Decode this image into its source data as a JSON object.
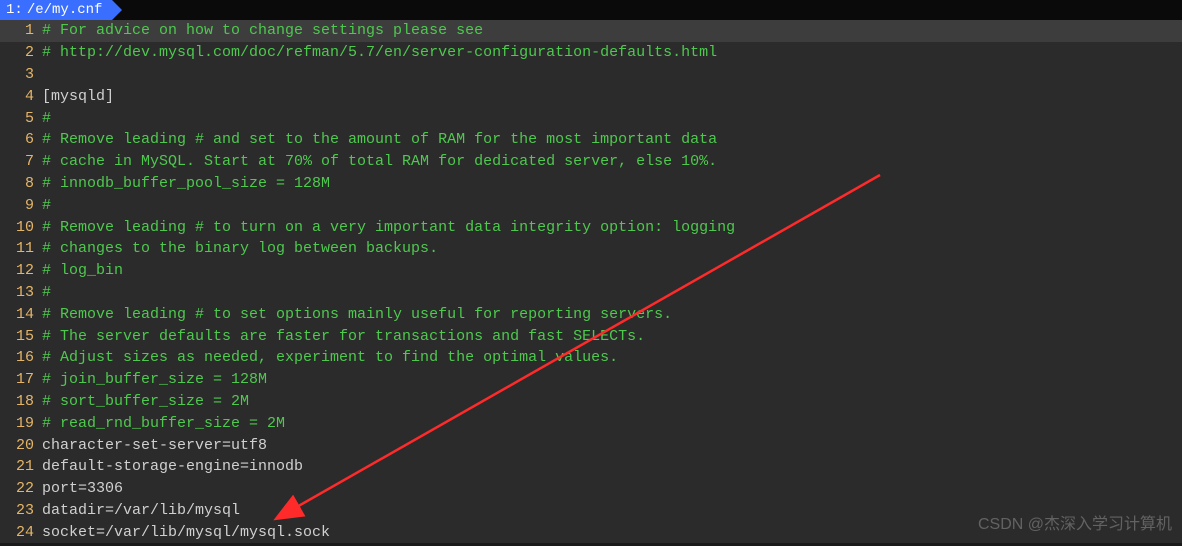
{
  "tab": {
    "number": "1:",
    "path": "/e/my.cnf"
  },
  "lines": [
    {
      "n": "1",
      "cls": "comment",
      "text": "# For advice on how to change settings please see",
      "hl": true
    },
    {
      "n": "2",
      "cls": "comment",
      "text": "# http://dev.mysql.com/doc/refman/5.7/en/server-configuration-defaults.html"
    },
    {
      "n": "3",
      "cls": "plain",
      "text": ""
    },
    {
      "n": "4",
      "cls": "section",
      "text": "[mysqld]"
    },
    {
      "n": "5",
      "cls": "comment",
      "text": "#"
    },
    {
      "n": "6",
      "cls": "comment",
      "text": "# Remove leading # and set to the amount of RAM for the most important data"
    },
    {
      "n": "7",
      "cls": "comment",
      "text": "# cache in MySQL. Start at 70% of total RAM for dedicated server, else 10%."
    },
    {
      "n": "8",
      "cls": "comment",
      "text": "# innodb_buffer_pool_size = 128M"
    },
    {
      "n": "9",
      "cls": "comment",
      "text": "#"
    },
    {
      "n": "10",
      "cls": "comment",
      "text": "# Remove leading # to turn on a very important data integrity option: logging"
    },
    {
      "n": "11",
      "cls": "comment",
      "text": "# changes to the binary log between backups."
    },
    {
      "n": "12",
      "cls": "comment",
      "text": "# log_bin"
    },
    {
      "n": "13",
      "cls": "comment",
      "text": "#"
    },
    {
      "n": "14",
      "cls": "comment",
      "text": "# Remove leading # to set options mainly useful for reporting servers."
    },
    {
      "n": "15",
      "cls": "comment",
      "text": "# The server defaults are faster for transactions and fast SELECTs."
    },
    {
      "n": "16",
      "cls": "comment",
      "text": "# Adjust sizes as needed, experiment to find the optimal values."
    },
    {
      "n": "17",
      "cls": "comment",
      "text": "# join_buffer_size = 128M"
    },
    {
      "n": "18",
      "cls": "comment",
      "text": "# sort_buffer_size = 2M"
    },
    {
      "n": "19",
      "cls": "comment",
      "text": "# read_rnd_buffer_size = 2M"
    },
    {
      "n": "20",
      "cls": "plain",
      "text": "character-set-server=utf8"
    },
    {
      "n": "21",
      "cls": "plain",
      "text": "default-storage-engine=innodb"
    },
    {
      "n": "22",
      "cls": "plain",
      "text": "port=3306"
    },
    {
      "n": "23",
      "cls": "plain",
      "text": "datadir=/var/lib/mysql"
    },
    {
      "n": "24",
      "cls": "plain",
      "text": "socket=/var/lib/mysql/mysql.sock"
    }
  ],
  "watermark": "CSDN @杰深入学习计算机"
}
